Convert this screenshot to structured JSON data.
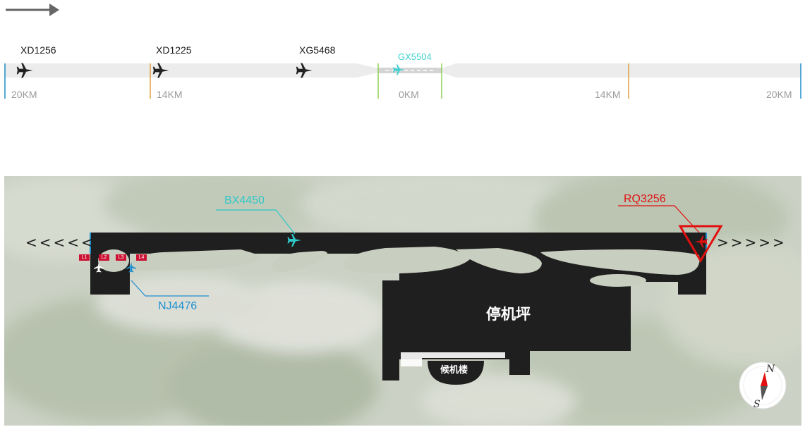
{
  "approach": {
    "flights": [
      {
        "callsign": "XD1256",
        "icon": "airplane-icon",
        "status": "inbound"
      },
      {
        "callsign": "XD1225",
        "icon": "airplane-icon",
        "status": "inbound"
      },
      {
        "callsign": "XG5468",
        "icon": "airplane-icon",
        "status": "inbound"
      },
      {
        "callsign": "GX5504",
        "icon": "airplane-icon",
        "status": "on-runway"
      }
    ],
    "distance_marks": [
      "20KM",
      "14KM",
      "0KM",
      "14KM",
      "20KM"
    ]
  },
  "map": {
    "left_direction": "<<<<<",
    "right_direction": ">>>>>",
    "apron_label": "停机坪",
    "terminal_label": "候机楼",
    "flights": [
      {
        "callsign": "BX4450",
        "color": "#2ec8c8",
        "icon": "airplane-icon"
      },
      {
        "callsign": "NJ4476",
        "color": "#1e90d0",
        "icon": "airplane-icon"
      },
      {
        "callsign": "RQ3256",
        "color": "#e01010",
        "icon": "airplane-alert-icon"
      }
    ],
    "gates": [
      "L1",
      "L2",
      "L3",
      "L4"
    ],
    "compass": {
      "north": "N",
      "south": "S"
    }
  },
  "colors": {
    "runway": "#1f1f1f",
    "lane": "#eeeeee",
    "marker_blue": "#1e8fc8",
    "marker_orange": "#e0a040",
    "marker_green": "#90d050",
    "alert_red": "#e01010"
  }
}
